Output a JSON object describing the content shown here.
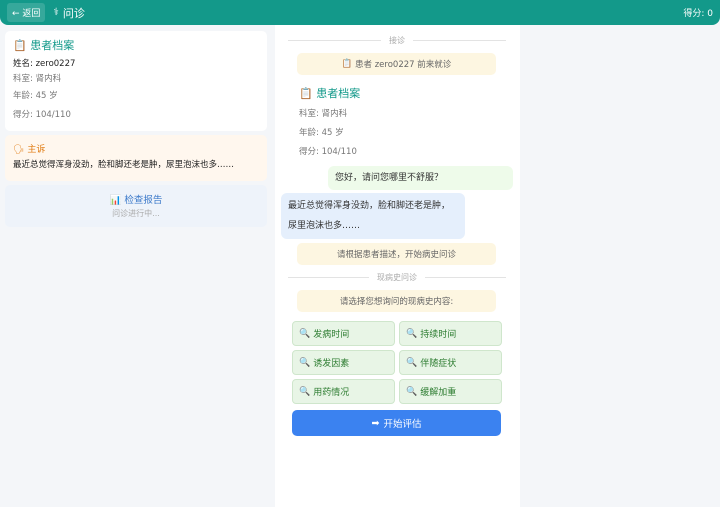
{
  "header": {
    "back": "← 返回",
    "title": "问诊",
    "score": "得分: 0"
  },
  "left": {
    "profile": {
      "title": "患者档案",
      "name": "姓名: zero0227",
      "dept": "科室: 肾内科",
      "age": "年龄: 45 岁",
      "score": "得分: 104/110"
    },
    "complaint": {
      "title": "主诉",
      "text": "最近总觉得浑身没劲，脸和脚还老是肿，尿里泡沫也多……"
    },
    "report": {
      "title": "检查报告",
      "status": "问诊进行中..."
    }
  },
  "chat": {
    "divider1": "接诊",
    "arrival": "患者 zero0227 前来就诊",
    "profile": {
      "title": "患者档案",
      "dept": "科室: 肾内科",
      "age": "年龄: 45 岁",
      "score": "得分: 104/110"
    },
    "doctor_msg": "您好，请问您哪里不舒服？",
    "patient_msg": "最近总觉得浑身没劲，脸和脚还老是肿，尿里泡沫也多……",
    "hint": "请根据患者描述，开始病史问诊",
    "divider2": "现病史问诊",
    "prompt": "请选择您想询问的现病史内容:",
    "options": [
      "发病时间",
      "持续时间",
      "诱发因素",
      "伴随症状",
      "用药情况",
      "缓解加重"
    ],
    "start": "开始评估"
  }
}
